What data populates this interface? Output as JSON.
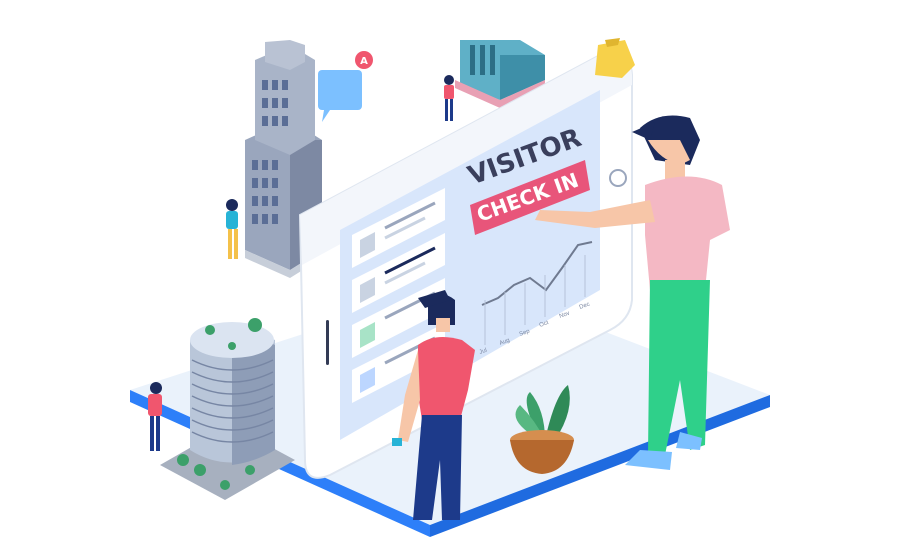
{
  "screen": {
    "title_line1": "VISITOR",
    "button_label": "CHECK IN",
    "notification_badge": "A",
    "chart_tick_labels": [
      "Jul",
      "Aug",
      "Sep",
      "Oct",
      "Nov",
      "Dec"
    ]
  },
  "colors": {
    "platform_top": "#eaf2fb",
    "platform_edge": "#2d7ff9",
    "screen_bg": "#d8e6fb",
    "card": "#ffffff",
    "button": "#e8557a",
    "title": "#3a3f5c",
    "shirt_pink": "#f4b8c4",
    "shirt_red": "#f0566e",
    "pants_green": "#2fd08a",
    "pants_navy": "#1d3a8a",
    "hair": "#1b2a5c",
    "skin": "#f7c6a8",
    "building": "#9aa6bd",
    "window": "#5b6e96",
    "plant": "#3ca06a",
    "pot": "#b5682e",
    "bubble": "#7cc0ff",
    "badge": "#f0566e",
    "lamp": "#f7d14a"
  }
}
